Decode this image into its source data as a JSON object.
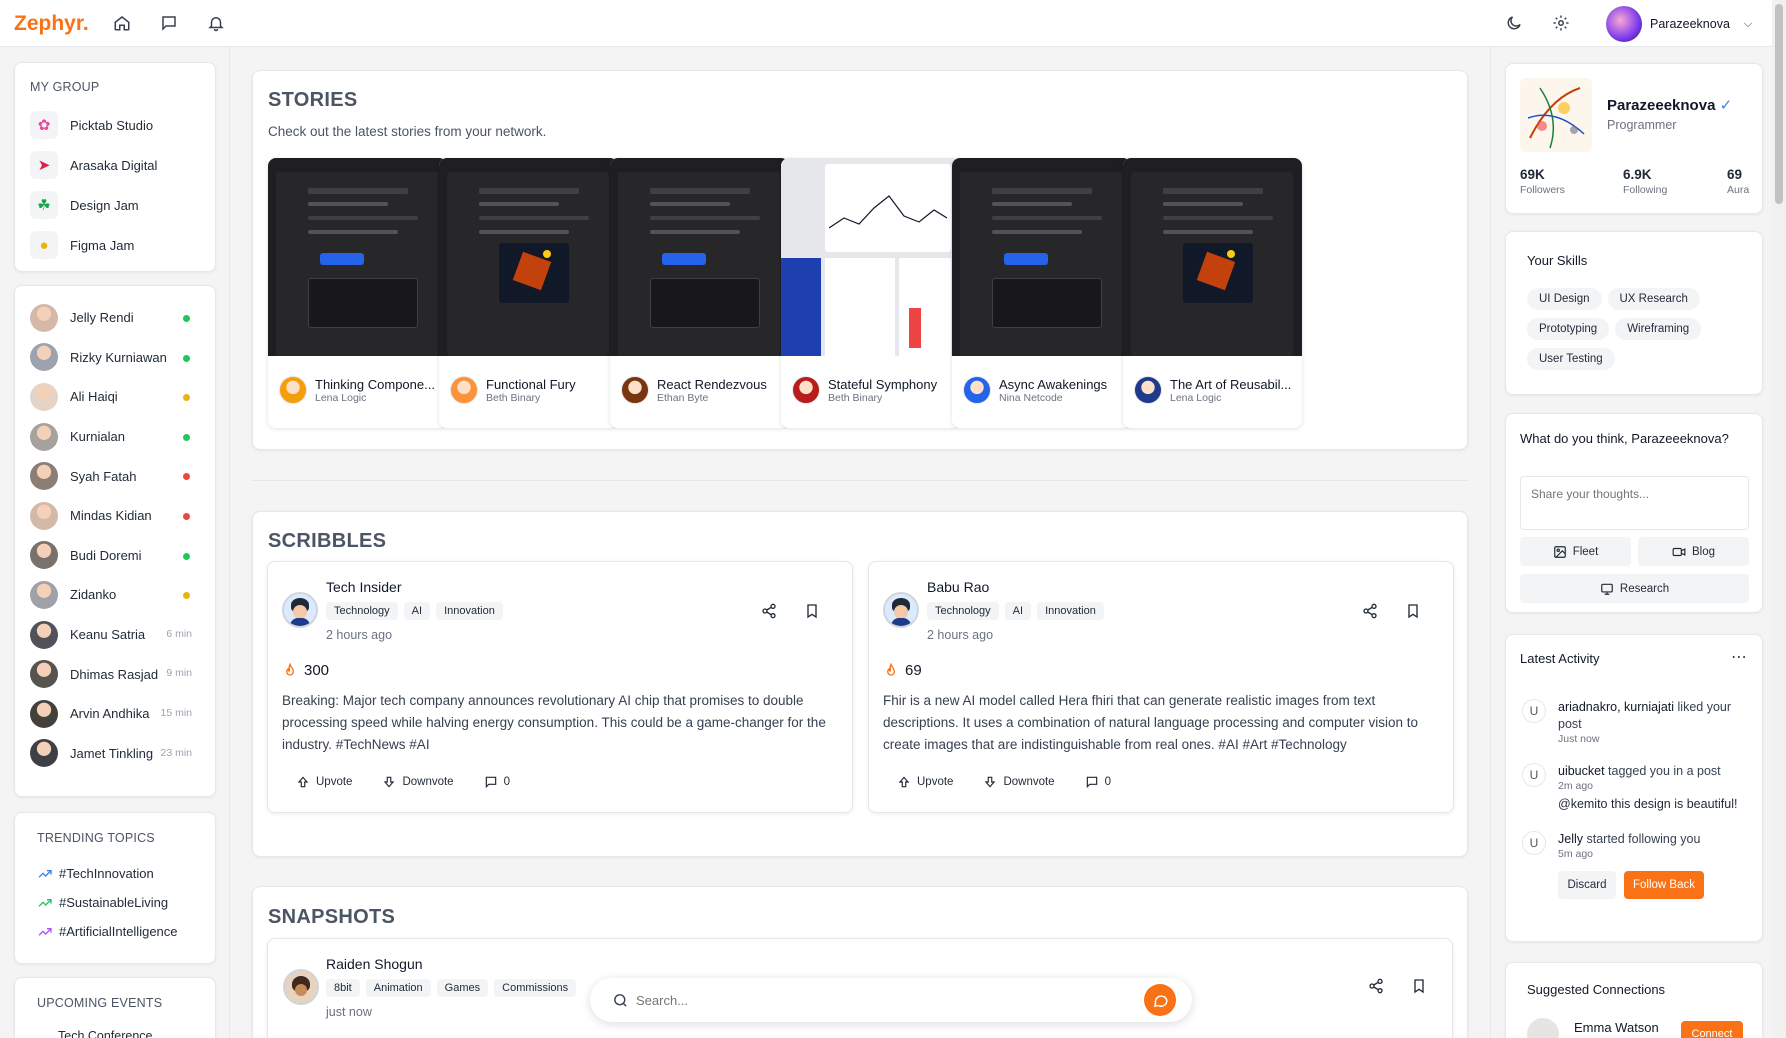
{
  "app": {
    "logo": "Zephyr.",
    "user_name": "Parazeeknova"
  },
  "colors": {
    "accent": "#f97316",
    "online": "#22c55e",
    "away": "#eab308",
    "busy": "#ef4444",
    "verified": "#3b82f6"
  },
  "my_group": {
    "title": "MY GROUP",
    "items": [
      {
        "label": "Picktab Studio",
        "icon": "flower-icon"
      },
      {
        "label": "Arasaka Digital",
        "icon": "rocket-icon"
      },
      {
        "label": "Design Jam",
        "icon": "cactus-icon"
      },
      {
        "label": "Figma Jam",
        "icon": "bulb-icon"
      }
    ]
  },
  "friends": [
    {
      "name": "Jelly Rendi",
      "status": "online"
    },
    {
      "name": "Rizky Kurniawan",
      "status": "online"
    },
    {
      "name": "Ali Haiqi",
      "status": "away"
    },
    {
      "name": "Kurnialan",
      "status": "online"
    },
    {
      "name": "Syah Fatah",
      "status": "busy"
    },
    {
      "name": "Mindas Kidian",
      "status": "busy"
    },
    {
      "name": "Budi Doremi",
      "status": "online"
    },
    {
      "name": "Zidanko",
      "status": "away"
    },
    {
      "name": "Keanu Satria",
      "mins": "6 min"
    },
    {
      "name": "Dhimas Rasjad",
      "mins": "9 min"
    },
    {
      "name": "Arvin Andhika",
      "mins": "15 min"
    },
    {
      "name": "Jamet Tinkling",
      "mins": "23 min"
    }
  ],
  "trending": {
    "title": "TRENDING TOPICS",
    "items": [
      "#TechInnovation",
      "#SustainableLiving",
      "#ArtificialIntelligence"
    ]
  },
  "events": {
    "title": "UPCOMING EVENTS",
    "items": [
      "Tech Conference"
    ]
  },
  "stories": {
    "title": "STORIES",
    "subtitle": "Check out the latest stories from your network.",
    "items": [
      {
        "title": "Thinking Compone...",
        "author": "Lena Logic"
      },
      {
        "title": "Functional Fury",
        "author": "Beth Binary"
      },
      {
        "title": "React Rendezvous",
        "author": "Ethan Byte"
      },
      {
        "title": "Stateful Symphony",
        "author": "Beth Binary"
      },
      {
        "title": "Async Awakenings",
        "author": "Nina Netcode"
      },
      {
        "title": "The Art of Reusabil...",
        "author": "Lena Logic"
      }
    ]
  },
  "scribbles": {
    "title": "SCRIBBLES",
    "posts": [
      {
        "author": "Tech Insider",
        "tags": [
          "Technology",
          "AI",
          "Innovation"
        ],
        "time": "2 hours ago",
        "fire": "300",
        "body": "Breaking: Major tech company announces revolutionary AI chip that promises to double processing speed while halving energy consumption. This could be a game-changer for the industry. #TechNews #AI",
        "upvote": "Upvote",
        "downvote": "Downvote",
        "comments": "0"
      },
      {
        "author": "Babu Rao",
        "tags": [
          "Technology",
          "AI",
          "Innovation"
        ],
        "time": "2 hours ago",
        "fire": "69",
        "body": "Fhir is a new AI model called Hera fhiri that can generate realistic images from text descriptions. It uses a combination of natural language processing and computer vision to create images that are indistinguishable from real ones. #AI #Art #Technology",
        "upvote": "Upvote",
        "downvote": "Downvote",
        "comments": "0"
      }
    ]
  },
  "snapshots": {
    "title": "SNAPSHOTS",
    "post": {
      "author": "Raiden Shogun",
      "tags": [
        "8bit",
        "Animation",
        "Games",
        "Commissions"
      ],
      "time": "just now"
    }
  },
  "search": {
    "placeholder": "Search..."
  },
  "profile": {
    "name": "Parazeeeknova",
    "role": "Programmer",
    "stats": [
      {
        "value": "69K",
        "label": "Followers"
      },
      {
        "value": "6.9K",
        "label": "Following"
      },
      {
        "value": "69",
        "label": "Aura"
      }
    ]
  },
  "skills": {
    "title": "Your Skills",
    "items": [
      "UI Design",
      "UX Research",
      "Prototyping",
      "Wireframing",
      "User Testing"
    ]
  },
  "composer": {
    "prompt": "What do you think, Parazeeeknova?",
    "placeholder": "Share your thoughts...",
    "fleet": "Fleet",
    "blog": "Blog",
    "research": "Research"
  },
  "activity": {
    "title": "Latest Activity",
    "items": [
      {
        "avatar": "U",
        "who": "ariadnakro, kurniajati",
        "text": " liked your post",
        "time": "Just now"
      },
      {
        "avatar": "U",
        "who": "uibucket",
        "text": " tagged you in a post",
        "time": "2m ago",
        "quote": "@kemito this design is beautiful!"
      },
      {
        "avatar": "U",
        "who": "Jelly",
        "text": " started following you",
        "time": "5m ago"
      }
    ],
    "discard": "Discard",
    "follow_back": "Follow Back"
  },
  "suggested": {
    "title": "Suggested Connections",
    "name": "Emma Watson",
    "connect": "Connect"
  }
}
